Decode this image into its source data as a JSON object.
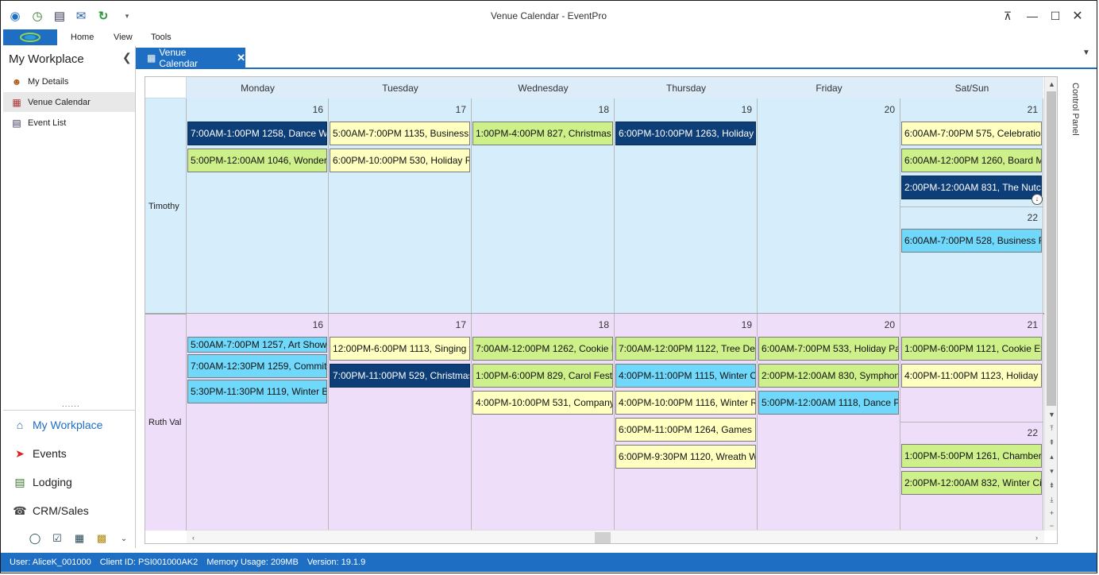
{
  "window": {
    "title": "Venue Calendar - EventPro"
  },
  "ribbon": {
    "menu": [
      "Home",
      "View",
      "Tools"
    ]
  },
  "nav": {
    "title": "My Workplace",
    "items": [
      {
        "label": "My Details",
        "icon": "person-icon"
      },
      {
        "label": "Venue Calendar",
        "icon": "calendar-icon"
      },
      {
        "label": "Event List",
        "icon": "list-icon"
      }
    ],
    "sections": [
      {
        "label": "My Workplace",
        "icon": "home-icon"
      },
      {
        "label": "Events",
        "icon": "pin-icon"
      },
      {
        "label": "Lodging",
        "icon": "lodging-icon"
      },
      {
        "label": "CRM/Sales",
        "icon": "crm-icon"
      }
    ],
    "grip": "......"
  },
  "doc_tab": {
    "label": "Venue Calendar"
  },
  "calendar": {
    "days": [
      "Monday",
      "Tuesday",
      "Wednesday",
      "Thursday",
      "Friday",
      "Sat/Sun"
    ],
    "resources": [
      {
        "name": "Timothy",
        "day_numbers": [
          "16",
          "17",
          "18",
          "19",
          "20",
          "21"
        ],
        "weekend_second_number": "22",
        "events": [
          [
            {
              "text": "7:00AM-1:00PM 1258, Dance Wor",
              "color": "navy"
            },
            {
              "text": "5:00PM-12:00AM 1046, Wonderla",
              "color": "green"
            }
          ],
          [
            {
              "text": "5:00AM-7:00PM 1135, Business C",
              "color": "yellow"
            },
            {
              "text": "6:00PM-10:00PM 530, Holiday Re",
              "color": "yellow"
            }
          ],
          [
            {
              "text": "1:00PM-4:00PM 827, Christmas C",
              "color": "green"
            }
          ],
          [
            {
              "text": "6:00PM-10:00PM 1263, Holiday St",
              "color": "navy"
            }
          ],
          [],
          [
            {
              "text": "6:00AM-7:00PM 575, Celebration",
              "color": "yellow"
            },
            {
              "text": "6:00AM-12:00PM 1260, Board Me",
              "color": "green"
            },
            {
              "text": "2:00PM-12:00AM 831, The Nutcra",
              "color": "navy"
            }
          ]
        ],
        "weekend_second_events": [
          {
            "text": "6:00AM-7:00PM 528, Business Re",
            "color": "cyan"
          }
        ]
      },
      {
        "name": "Ruth Val",
        "day_numbers": [
          "16",
          "17",
          "18",
          "19",
          "20",
          "21"
        ],
        "weekend_second_number": "22",
        "events": [
          [
            {
              "text": "5:00AM-7:00PM 1257, Art Show",
              "color": "cyan",
              "short": true
            },
            {
              "text": "7:00AM-12:30PM 1259, Committe",
              "color": "cyan"
            },
            {
              "text": "5:30PM-11:30PM 1119, Winter Ba",
              "color": "cyan"
            }
          ],
          [
            {
              "text": "12:00PM-6:00PM 1113, Singing w",
              "color": "yellow"
            },
            {
              "text": "7:00PM-11:00PM 529, Christmas",
              "color": "navy"
            }
          ],
          [
            {
              "text": "7:00AM-12:00PM 1262, Cookie Ex",
              "color": "green"
            },
            {
              "text": "1:00PM-6:00PM 829, Carol Festiva",
              "color": "green"
            },
            {
              "text": "4:00PM-10:00PM 531, Company B",
              "color": "yellow"
            }
          ],
          [
            {
              "text": "7:00AM-12:00PM 1122, Tree Deco",
              "color": "green"
            },
            {
              "text": "4:00PM-11:00PM 1115, Winter Ch",
              "color": "cyan"
            },
            {
              "text": "4:00PM-10:00PM 1116, Winter Re",
              "color": "yellow"
            },
            {
              "text": "6:00PM-11:00PM 1264, Games Ni",
              "color": "yellow"
            },
            {
              "text": "6:00PM-9:30PM 1120, Wreath Wo",
              "color": "yellow"
            }
          ],
          [
            {
              "text": "6:00AM-7:00PM 533, Holiday Part",
              "color": "green"
            },
            {
              "text": "2:00PM-12:00AM 830, Symphony",
              "color": "green"
            },
            {
              "text": "5:00PM-12:00AM 1118, Dance Par",
              "color": "cyan"
            }
          ],
          [
            {
              "text": "1:00PM-6:00PM 1121, Cookie Exc",
              "color": "green"
            },
            {
              "text": "4:00PM-11:00PM 1123, Holiday B",
              "color": "yellow"
            }
          ]
        ],
        "weekend_second_events": [
          {
            "text": "1:00PM-5:00PM 1261, Chamber M",
            "color": "green"
          },
          {
            "text": "2:00PM-12:00AM 832, Winter Cirq",
            "color": "green"
          }
        ]
      }
    ],
    "colors": {
      "yellow": "#ffffc0",
      "green": "#cdf08a",
      "cyan": "#70d8fa",
      "navy": "#0d3e78",
      "row1_bg": "#d6edfb",
      "row2_bg": "#efdefa"
    }
  },
  "control_panel": {
    "label": "Control Panel"
  },
  "status": {
    "user": "User: AliceK_001000",
    "client": "Client ID: PSI001000AK2",
    "memory": "Memory Usage: 209MB",
    "version": "Version: 19.1.9"
  }
}
